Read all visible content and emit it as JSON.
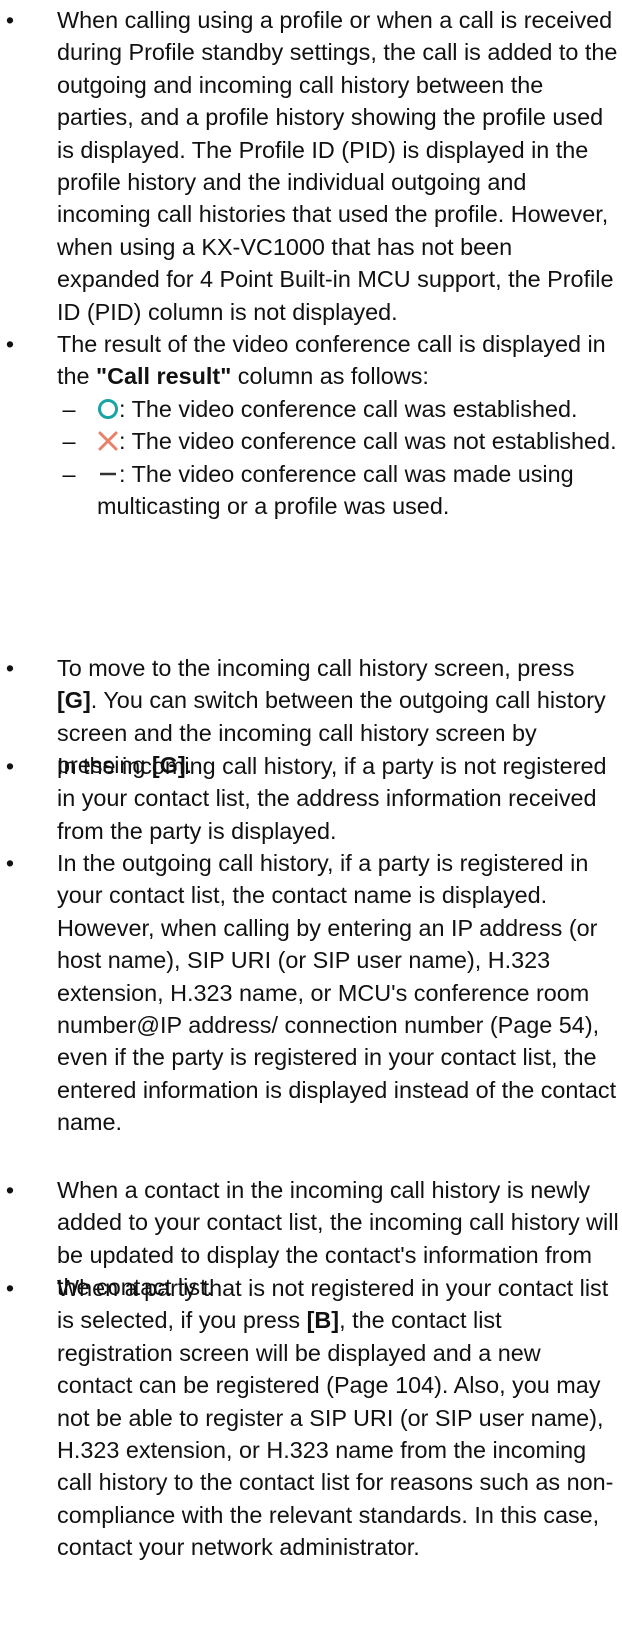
{
  "bullets": [
    "When calling using a profile or when a call is received during Profile standby settings, the call is added to the outgoing and incoming call history between the parties, and a profile history showing the profile used is displayed. The Profile ID (PID) is displayed in the profile history and the individual outgoing and incoming call histories that used the profile. However, when using a KX-VC1000 that has not been expanded for 4 Point Built-in MCU support, the Profile ID (PID) column is not displayed.",
    {
      "before": "The result of the video conference call is displayed in the ",
      "bold": "\"Call result\"",
      "after": " column as follows:"
    },
    {
      "p1": "To move to the incoming call history screen, press ",
      "b1": "[G]",
      "p2": ". You can switch between the outgoing call history screen and the incoming call history screen by pressing ",
      "b2": "[G]",
      "p3": "."
    },
    "In the incoming call history, if a party is not registered in your contact list, the address information received from the party is displayed.",
    "In the outgoing call history, if a party is registered in your contact list, the contact name is displayed. However, when calling by entering an IP address (or host name), SIP URI (or SIP user name), H.323 extension, H.323 name, or MCU's conference room number@IP address/ connection number (Page 54), even if the party is registered in your contact list, the entered information is displayed instead of the contact name.",
    "When a contact in the incoming call history is newly added to your contact list, the incoming call history will be updated to display the contact's information from the contact list.",
    {
      "p1": "When a party that is not registered in your contact list is selected, if you press ",
      "b1": "[B]",
      "p2": ", the contact list registration screen will be displayed and a new contact can be registered (Page 104). Also, you may not be able to register a SIP URI (or SIP user name), H.323 extension, or H.323 name from the incoming call history to the contact list for reasons such as non-compliance with the relevant standards. In this case, contact your network administrator."
    }
  ],
  "call_results": [
    {
      "icon": "circle-icon",
      "text": ": The video conference call was established."
    },
    {
      "icon": "cross-icon",
      "text": ": The video conference call was not established."
    },
    {
      "icon": "bar-icon",
      "text": ": The video conference call was made using multicasting or a profile was used."
    }
  ],
  "colors": {
    "circle": "#1aa3a3",
    "cross": "#e8806a",
    "bar": "#333333",
    "text": "#111111"
  }
}
